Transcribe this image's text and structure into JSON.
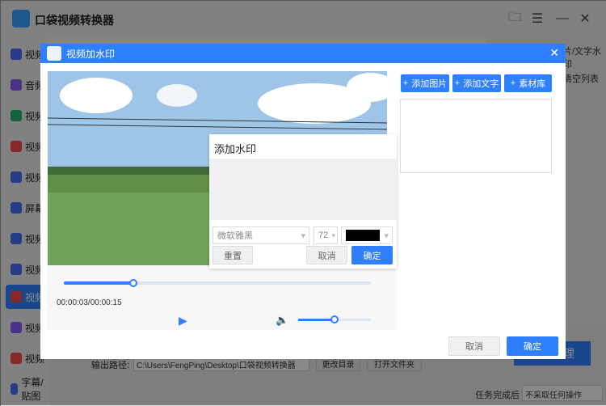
{
  "app": {
    "title": "口袋视频转换器"
  },
  "sidebar": {
    "items": [
      {
        "label": "视频"
      },
      {
        "label": "音频"
      },
      {
        "label": "视频"
      },
      {
        "label": "视频"
      },
      {
        "label": "视频"
      },
      {
        "label": "屏幕"
      },
      {
        "label": "视频"
      },
      {
        "label": "视频"
      },
      {
        "label": "视频"
      },
      {
        "label": "视频"
      },
      {
        "label": "视频"
      },
      {
        "label": "字幕/贴图"
      }
    ]
  },
  "bg": {
    "right_tab": "片/文字水印",
    "clear_list": "清空列表",
    "output_label": "输出路径:",
    "output_path": "C:\\Users\\FengPing\\Desktop\\口袋视频转换器",
    "change_dir": "更改目录",
    "open_folder": "打开文件夹",
    "convert": "理",
    "task_done_label": "任务完成后",
    "task_done_value": "不采取任何操作"
  },
  "dialog": {
    "title": "视频加水印",
    "add_image": "添加图片",
    "add_text": "添加文字",
    "material": "素材库",
    "time": "00:00:03/00:00:15",
    "progress": 0.2,
    "volume": 0.5,
    "watermark": {
      "title": "添加水印",
      "font": "微软雅黑",
      "size": "72",
      "color": "#000000",
      "reset": "重置",
      "cancel": "取消",
      "ok": "确定"
    },
    "cancel": "取消",
    "ok": "确定"
  }
}
